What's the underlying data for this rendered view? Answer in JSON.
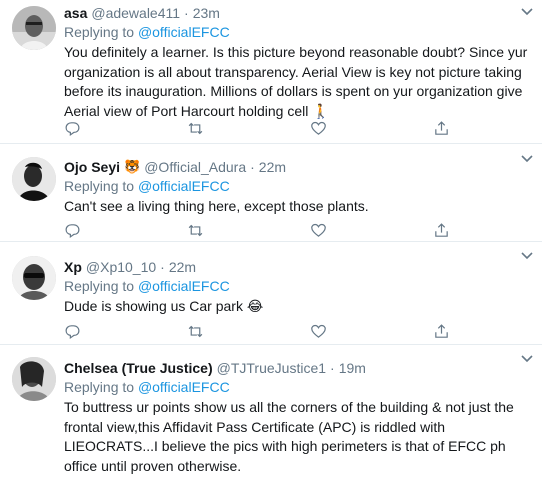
{
  "replies": [
    {
      "name": "asa",
      "name_emoji": "",
      "handle": "@adewale411",
      "dot": "·",
      "time": "23m",
      "replying_prefix": "Replying to",
      "replying_to": "@officialEFCC",
      "text": "You definitely a learner. Is this picture beyond reasonable doubt? Since yur organization is all about transparency. Aerial View is key not picture taking before its inauguration. Millions of dollars is spent on yur organization give Aerial view of Port Harcourt holding cell 🚶",
      "avatar": "avatar-asa-icon"
    },
    {
      "name": "Ojo Seyi",
      "name_emoji": "🐯",
      "handle": "@Official_Adura",
      "dot": "·",
      "time": "22m",
      "replying_prefix": "Replying to",
      "replying_to": "@officialEFCC",
      "text": "Can't see a living thing here, except those plants.",
      "avatar": "avatar-ojo-icon"
    },
    {
      "name": "Xp",
      "name_emoji": "",
      "handle": "@Xp10_10",
      "dot": "·",
      "time": "22m",
      "replying_prefix": "Replying to",
      "replying_to": "@officialEFCC",
      "text": "Dude is showing us Car park 😂",
      "avatar": "avatar-xp-icon"
    },
    {
      "name": "Chelsea (True Justice)",
      "name_emoji": "",
      "handle": "@TJTrueJustice1",
      "dot": "·",
      "time": "19m",
      "replying_prefix": "Replying to",
      "replying_to": "@officialEFCC",
      "text": "To buttress ur points show us all the corners of the building & not just the frontal view,this Affidavit Pass Certificate (APC) is riddled with LIEOCRATS...I believe the pics with high perimeters is that of EFCC ph office until proven otherwise.",
      "avatar": "avatar-chelsea-icon"
    }
  ],
  "icons": {
    "reply": "reply-icon",
    "retweet": "retweet-icon",
    "like": "heart-icon",
    "share": "share-icon",
    "caret": "chevron-down-icon"
  },
  "colors": {
    "link": "#1b95e0",
    "muted": "#657786",
    "text": "#14171a",
    "divider": "#e6ecf0"
  }
}
